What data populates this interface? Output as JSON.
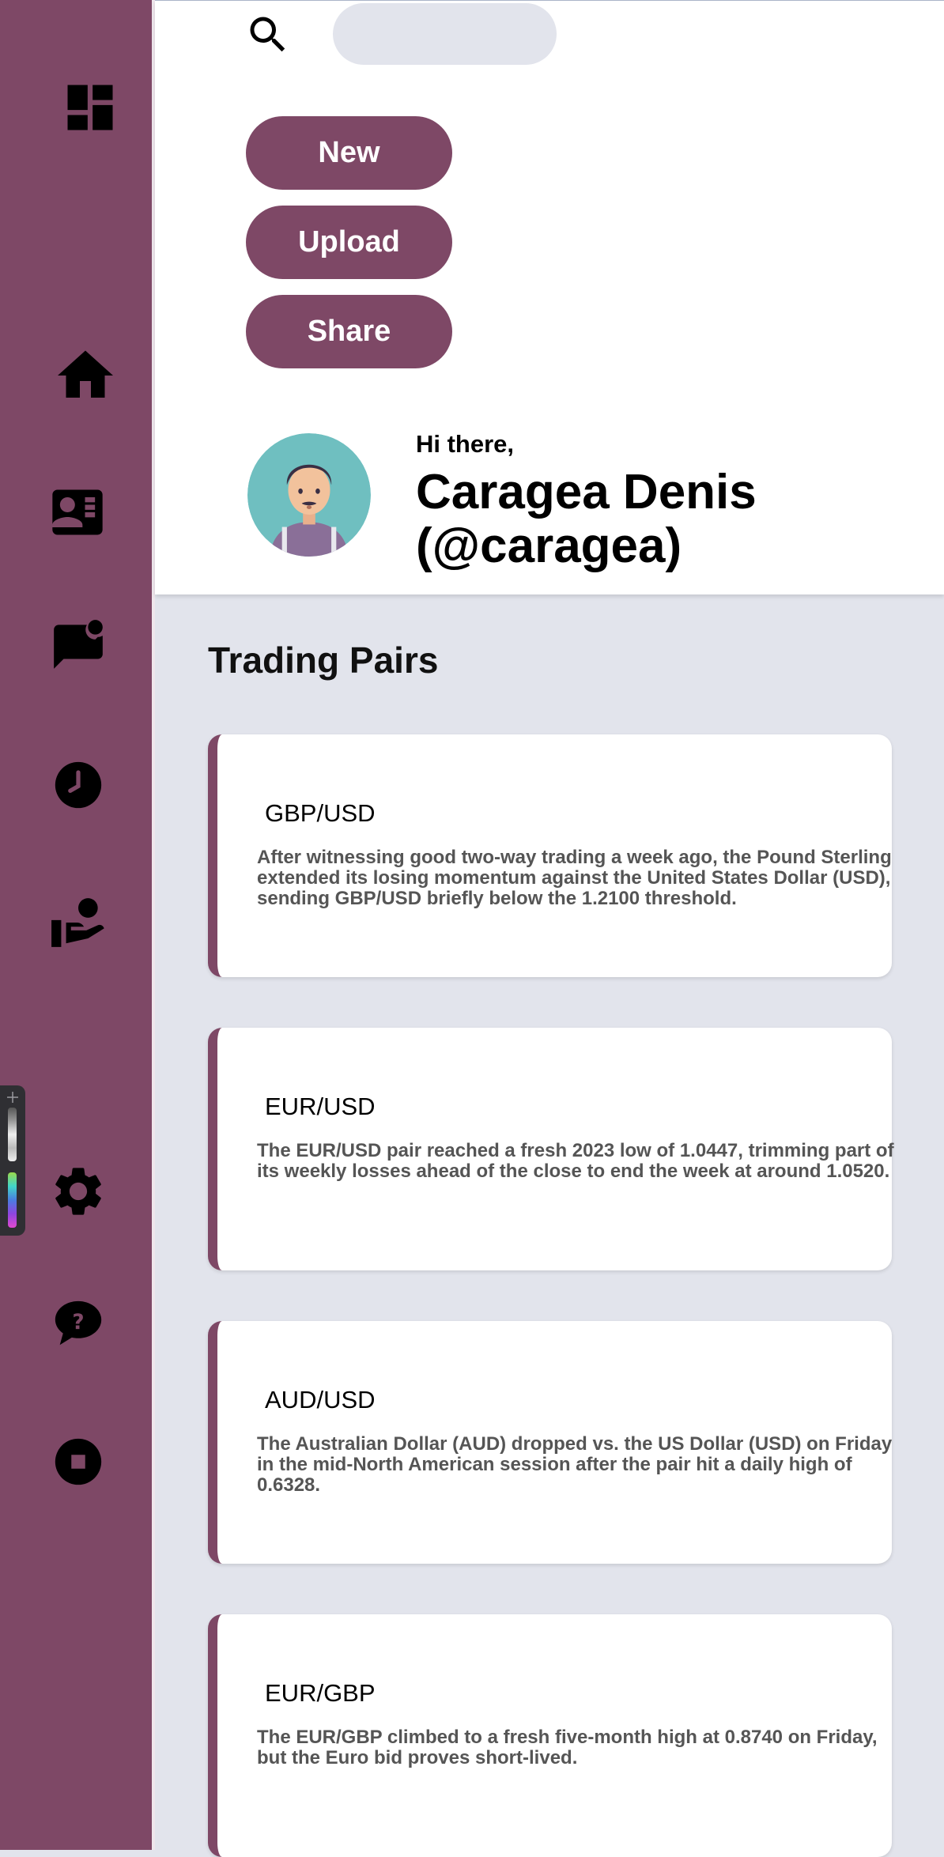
{
  "search": {
    "placeholder": ""
  },
  "actions": {
    "new_label": "New",
    "upload_label": "Upload",
    "share_label": "Share"
  },
  "profile": {
    "greeting": "Hi there,",
    "name": "Caragea Denis (@caragea)"
  },
  "section": {
    "title": "Trading Pairs"
  },
  "pairs": [
    {
      "title": "GBP/USD",
      "text": "After witnessing good two-way trading a week ago, the Pound Sterling extended its losing momentum against the United States Dollar (USD), sending GBP/USD briefly below the 1.2100 threshold."
    },
    {
      "title": "EUR/USD",
      "text": "The EUR/USD pair reached a fresh 2023 low of 1.0447, trimming part of its weekly losses ahead of the close to end the week at around 1.0520."
    },
    {
      "title": "AUD/USD",
      "text": "The Australian Dollar (AUD) dropped vs. the US Dollar (USD) on Friday in the mid-North American session after the pair hit a daily high of 0.6328."
    },
    {
      "title": "EUR/GBP",
      "text": "The EUR/GBP climbed to a fresh five-month high at 0.8740 on Friday, but the Euro bid proves short-lived."
    }
  ],
  "sidebar_icons": [
    "dashboard-icon",
    "home-icon",
    "contact-card-icon",
    "chat-notification-icon",
    "clock-icon",
    "volunteer-icon",
    "settings-icon",
    "help-icon",
    "stop-icon"
  ],
  "colors": {
    "accent": "#7e4866",
    "background": "#e2e4ec",
    "card": "#ffffff"
  }
}
